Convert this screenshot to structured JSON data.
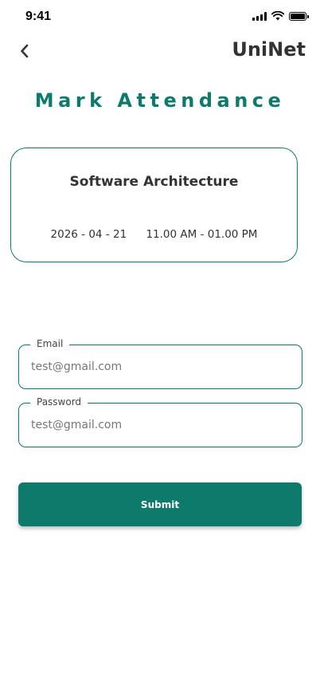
{
  "status_bar": {
    "time": "9:41",
    "icons": [
      "signal-icon",
      "wifi-icon",
      "battery-icon"
    ]
  },
  "header": {
    "back_icon": "chevron-left-icon",
    "app_name": "UniNet"
  },
  "page_title": "Mark Attendance",
  "course": {
    "name": "Software Architecture",
    "date": "2026 - 04 - 21",
    "time": "11.00 AM - 01.00 PM"
  },
  "form": {
    "email": {
      "label": "Email",
      "placeholder": "test@gmail.com",
      "value": ""
    },
    "password": {
      "label": "Password",
      "placeholder": "test@gmail.com",
      "value": ""
    },
    "submit_label": "Submit"
  },
  "colors": {
    "accent": "#0e7a6c",
    "text": "#333333",
    "background": "#ffffff"
  }
}
